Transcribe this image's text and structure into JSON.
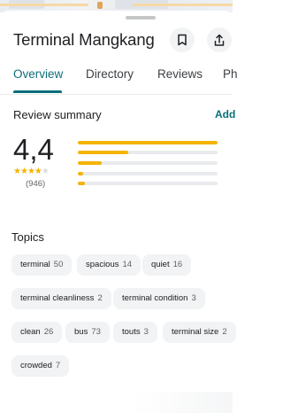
{
  "place": {
    "title": "Terminal Mangkang"
  },
  "actions": {
    "save_icon": "bookmark-icon",
    "share_icon": "share-icon"
  },
  "tabs": [
    {
      "label": "Overview",
      "active": true
    },
    {
      "label": "Directory"
    },
    {
      "label": "Reviews"
    },
    {
      "label": "Ph"
    }
  ],
  "review_summary": {
    "title": "Review summary",
    "add_label": "Add",
    "rating": "4,4",
    "stars": 4.4,
    "count": "(946)",
    "distribution": [
      1.0,
      0.36,
      0.17,
      0.04,
      0.05
    ]
  },
  "topics": {
    "title": "Topics",
    "chips": [
      {
        "label": "terminal",
        "count": "50"
      },
      {
        "label": "spacious",
        "count": "14"
      },
      {
        "label": "quiet",
        "count": "16"
      },
      {
        "label": "terminal cleanliness",
        "count": "2"
      },
      {
        "label": "terminal condition",
        "count": "3"
      },
      {
        "label": "clean",
        "count": "26"
      },
      {
        "label": "bus",
        "count": "73"
      },
      {
        "label": "touts",
        "count": "3"
      },
      {
        "label": "terminal size",
        "count": "2"
      },
      {
        "label": "crowded",
        "count": "7"
      }
    ]
  },
  "colors": {
    "accent": "#0b6e79",
    "star": "#f4b400",
    "chip_bg": "#f1f3f4"
  }
}
